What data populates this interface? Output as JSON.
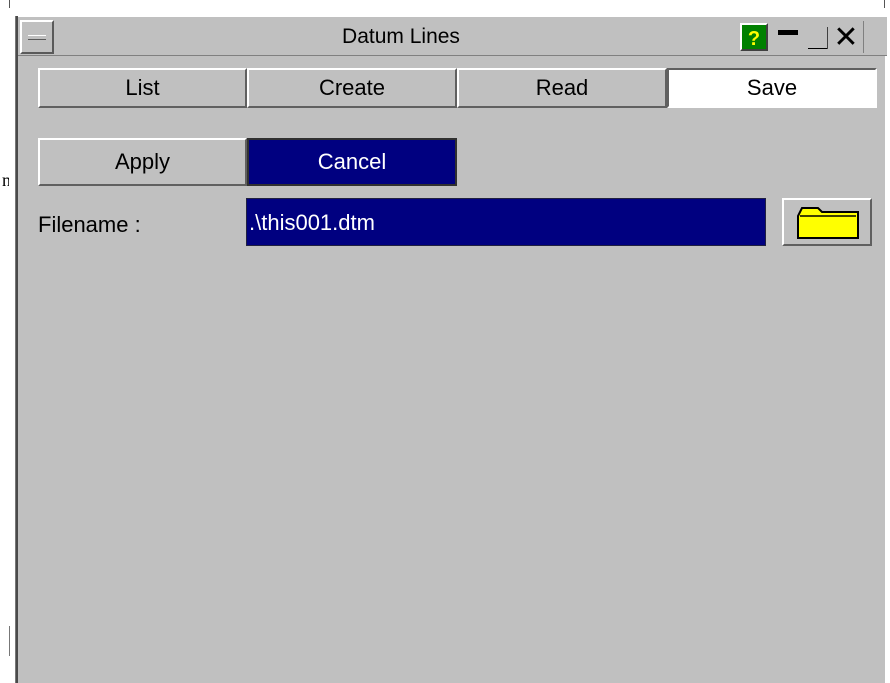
{
  "window": {
    "title": "Datum Lines",
    "help_label": "?"
  },
  "tabs": [
    {
      "label": "List"
    },
    {
      "label": "Create"
    },
    {
      "label": "Read"
    },
    {
      "label": "Save",
      "active": true
    }
  ],
  "actions": {
    "apply_label": "Apply",
    "cancel_label": "Cancel"
  },
  "filename": {
    "label": "Filename :",
    "value": ".\\this001.dtm"
  },
  "colors": {
    "panel": "#c0c0c0",
    "selection": "#000080",
    "help": "#008000",
    "folder": "#ffff00"
  },
  "icons": [
    "menu-icon",
    "help-icon",
    "minimize-icon",
    "maximize-icon",
    "close-icon",
    "folder-icon"
  ],
  "stray_text": "n"
}
